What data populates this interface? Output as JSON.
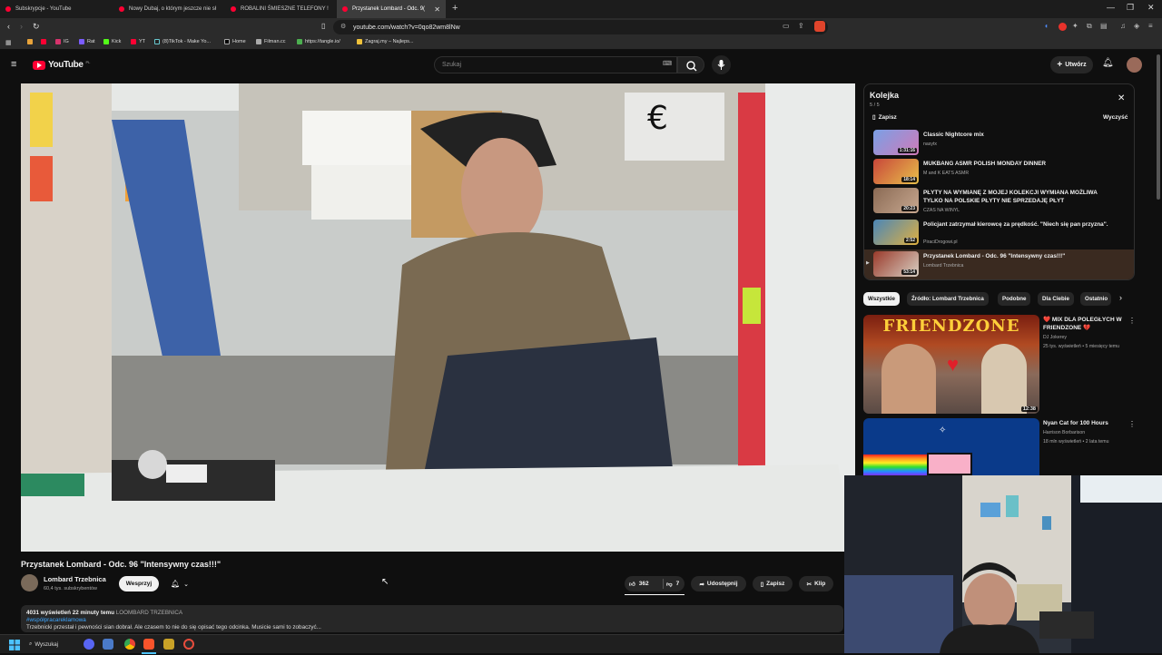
{
  "browser": {
    "tabs": [
      {
        "label": "Subskrypcje - YouTube",
        "active": false
      },
      {
        "label": "Nowy Dubaj, o którym jeszcze nie sł",
        "active": false
      },
      {
        "label": "ROBALINI ŚMIESZNE TELEFONY !",
        "active": false
      },
      {
        "label": "Przystanek Lombard - Odc. 9(",
        "active": true
      }
    ],
    "url": "youtube.com/watch?v=0qo82wm8lNw",
    "bookmarks": [
      "IG",
      "Rat",
      "Kick",
      "YT",
      "(8)TikTok - Make Yo...",
      "Home",
      "Filman.cc",
      "https://tangle.io/",
      "Zagraj.my – Najleps..."
    ]
  },
  "youtube": {
    "logo_text": "YouTube",
    "logo_region": "PL",
    "search_placeholder": "Szukaj",
    "create_label": "Utwórz",
    "video": {
      "title": "Przystanek Lombard - Odc. 96 \"Intensywny czas!!!\"",
      "channel": "Lombard Trzebnica",
      "subscribers": "60,4 tys. subskrybentów",
      "support_label": "Wesprzyj",
      "likes": "362",
      "dislikes": "7",
      "share_label": "Udostępnij",
      "save_label": "Zapisz",
      "clip_label": "Klip",
      "views": "4031 wyświetleń",
      "age": "22 minuty temu",
      "channel_tag": "LOOMBARD TRZEBNICA",
      "hashtag": "#współpracareklamowa",
      "desc_line": "Trzebnicki przestał i pewności sian dobrał. Ale czasem to nie do się opisać tego odcinka. Musicie sami to zobaczyć..."
    },
    "queue": {
      "title": "Kolejka",
      "position": "5 / 5",
      "save_label": "Zapisz",
      "clear_label": "Wyczyść",
      "items": [
        {
          "title": "Classic Nightcore mix",
          "channel": "nasytx",
          "duration": "1:31:16",
          "color": "#6a8fd8"
        },
        {
          "title": "MUKBANG ASMR POLISH MONDAY DINNER",
          "channel": "M and K EATS ASMR",
          "duration": "18:14",
          "color": "#b0402c"
        },
        {
          "title": "PŁYTY NA WYMIANĘ Z MOJEJ KOLEKCJI WYMIANA MOŻLIWA TYLKO NA POLSKIE PŁYTY NIE SPRZEDAJĘ PŁYT",
          "channel": "CZAS NA WINYL",
          "duration": "20:23",
          "color": "#7d5a44"
        },
        {
          "title": "Policjant zatrzymał kierowcę za prędkość. \"Niech się pan przyzna\".",
          "channel": "PiraciDrogowi.pl",
          "duration": "2:52",
          "color": "#3f6a8a"
        },
        {
          "title": "Przystanek Lombard - Odc. 96 \"Intensywny czas!!!\"",
          "channel": "Lombard Trzebnica",
          "duration": "53:14",
          "color": "#8a3a2a"
        }
      ]
    },
    "chips": [
      "Wszystkie",
      "Źródło: Lombard Trzebnica",
      "Podobne",
      "Dla Ciebie",
      "Ostatnio"
    ],
    "recommendations": [
      {
        "title": "❤️ MIX DLA POLEGŁYCH W FRIENDZONE 💔",
        "channel": "DJ Jokerey",
        "meta": "25 tys. wyświetleń • 5 miesięcy temu",
        "duration": "12:38",
        "thumb_text": "FRIENDZONE"
      },
      {
        "title": "Nyan Cat for 100 Hours",
        "channel": "Harrison Borbarison",
        "meta": "18 mln wyświetleń • 2 lata temu",
        "duration": ""
      }
    ]
  },
  "taskbar": {
    "search_label": "Wyszukaj"
  }
}
